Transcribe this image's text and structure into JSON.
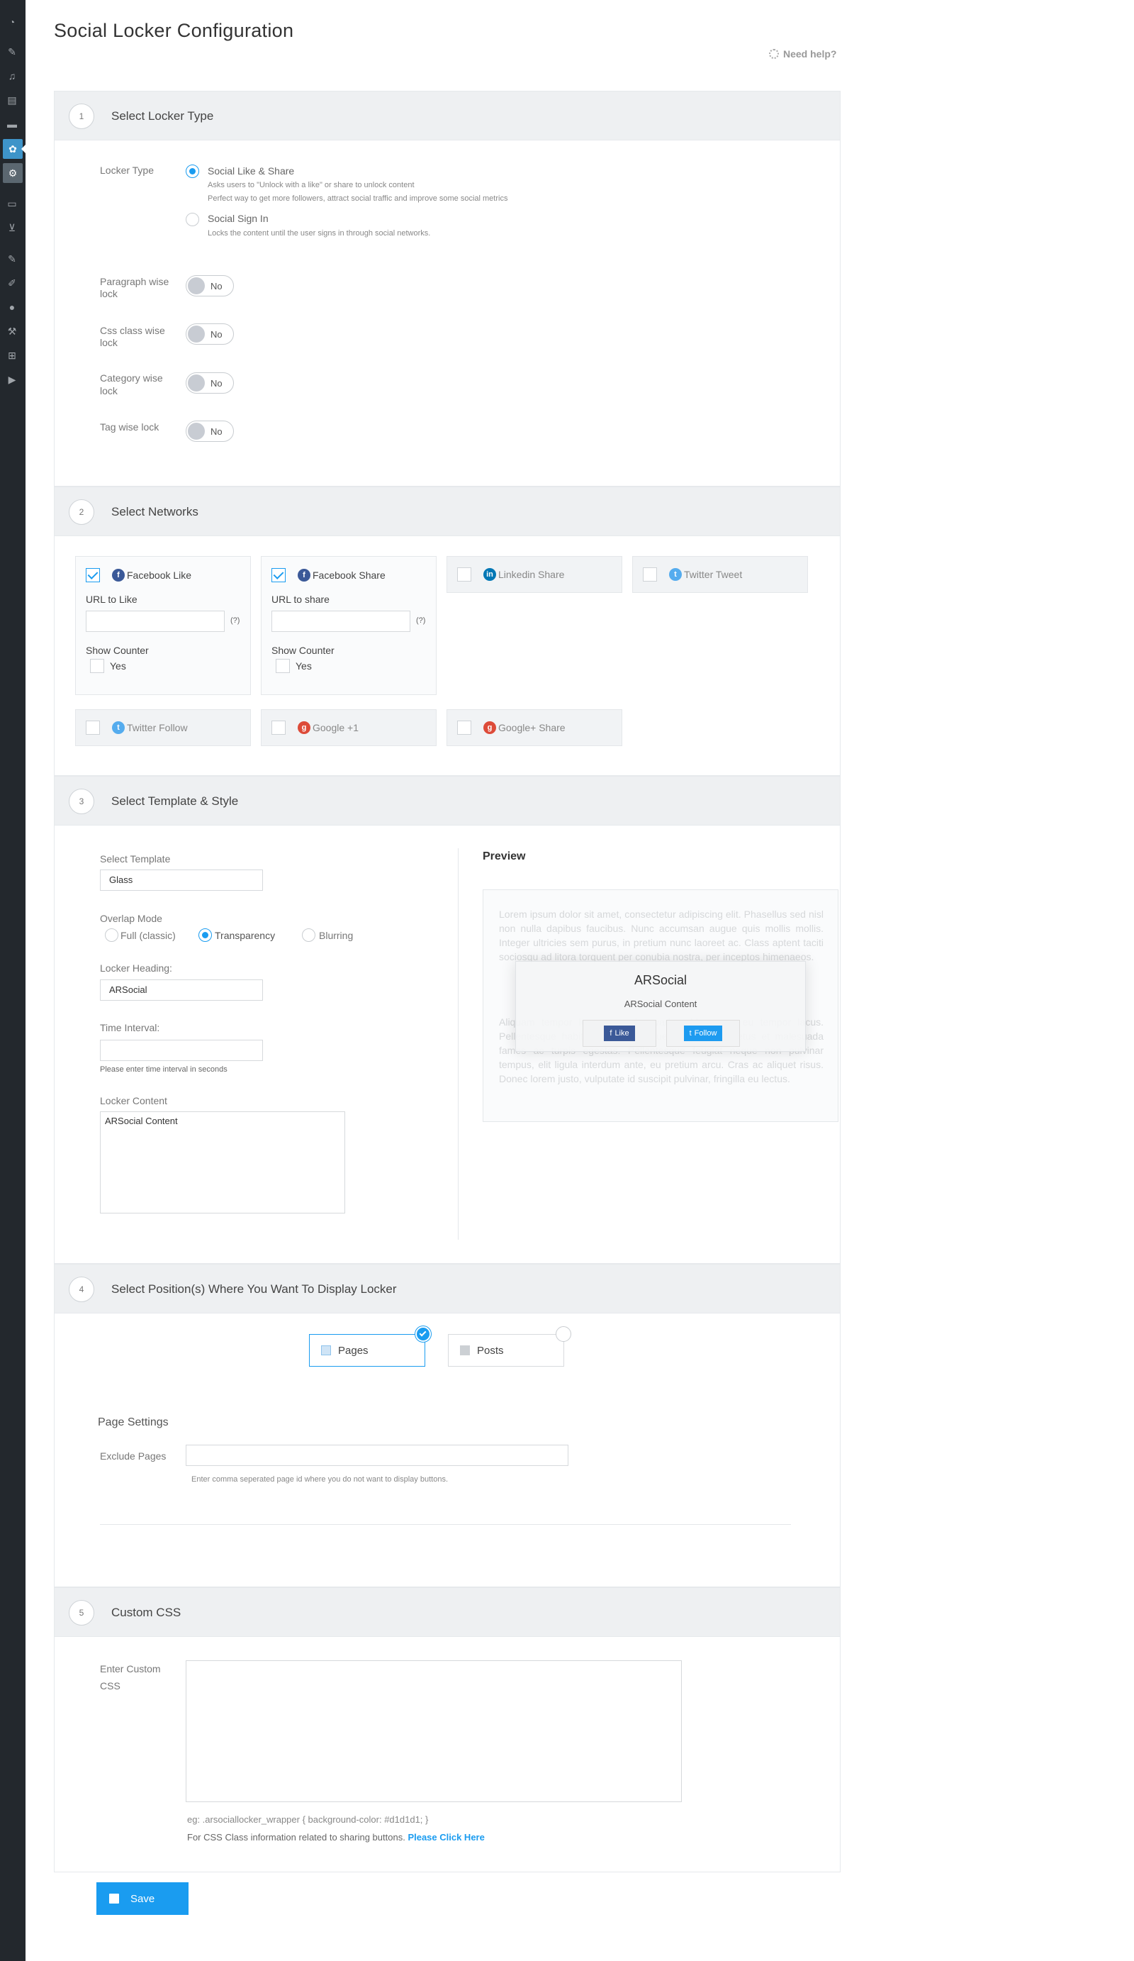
{
  "page": {
    "title": "Social Locker Configuration",
    "help_label": "Need help?"
  },
  "sidebar": {
    "icons": [
      "dashboard-icon",
      "pin-icon",
      "media-icon",
      "pages-icon",
      "comments-icon",
      "social-locker-icon",
      "locker-settings-icon",
      "forms-icon",
      "cart-icon",
      "plugins-icon",
      "appearance-icon",
      "users-icon",
      "tools-icon",
      "settings-icon",
      "play-icon"
    ]
  },
  "sections": {
    "s1": {
      "num": "1",
      "title": "Select Locker Type"
    },
    "s2": {
      "num": "2",
      "title": "Select Networks"
    },
    "s3": {
      "num": "3",
      "title": "Select Template & Style"
    },
    "s4": {
      "num": "4",
      "title": "Select Position(s) Where You Want To Display Locker"
    },
    "s5": {
      "num": "5",
      "title": "Custom CSS"
    }
  },
  "locker_type": {
    "label": "Locker Type",
    "opt1": {
      "label": "Social Like & Share",
      "desc1": "Asks users to \"Unlock with a like\" or share to unlock content",
      "desc2": "Perfect way to get more followers, attract social traffic and improve some social metrics",
      "selected": true
    },
    "opt2": {
      "label": "Social Sign In",
      "desc": "Locks the content until the user signs in through social networks.",
      "selected": false
    }
  },
  "toggles": {
    "paragraph": {
      "label1": "Paragraph wise",
      "label2": "lock",
      "value": "No"
    },
    "css": {
      "label1": "Css class wise",
      "label2": "lock",
      "value": "No"
    },
    "category": {
      "label1": "Category wise",
      "label2": "lock",
      "value": "No"
    },
    "tag": {
      "label": "Tag wise lock",
      "value": "No"
    }
  },
  "networks": {
    "fb_like": {
      "label": "Facebook Like",
      "checked": true,
      "url_label": "URL to Like",
      "url_value": "",
      "help": "(?)",
      "counter_label": "Show Counter",
      "counter_opt": "Yes"
    },
    "fb_share": {
      "label": "Facebook Share",
      "checked": true,
      "url_label": "URL to share",
      "url_value": "",
      "help": "(?)",
      "counter_label": "Show Counter",
      "counter_opt": "Yes"
    },
    "linkedin": {
      "label": "Linkedin Share",
      "checked": false
    },
    "tw_tweet": {
      "label": "Twitter Tweet",
      "checked": false
    },
    "tw_follow": {
      "label": "Twitter Follow",
      "checked": false
    },
    "gplus1": {
      "label": "Google +1",
      "checked": false
    },
    "gplus_share": {
      "label": "Google+ Share",
      "checked": false
    }
  },
  "template": {
    "select_label": "Select Template",
    "select_value": "Glass",
    "overlap_label": "Overlap Mode",
    "overlap_opts": [
      "Full (classic)",
      "Transparency",
      "Blurring"
    ],
    "overlap_selected": "Transparency",
    "heading_label": "Locker Heading:",
    "heading_value": "ARSocial",
    "interval_label": "Time Interval:",
    "interval_value": "",
    "interval_hint": "Please enter time interval in seconds",
    "content_label": "Locker Content",
    "content_value": "ARSocial Content"
  },
  "preview": {
    "title": "Preview",
    "lorem1": "Lorem ipsum dolor sit amet, consectetur adipiscing elit. Phasellus sed nisl non nulla dapibus faucibus. Nunc accumsan augue quis mollis mollis. Integer ultricies sem purus, in pretium nunc laoreet ac. Class aptent taciti sociosqu ad litora torquent per conubia nostra, per inceptos himenaeos.",
    "lorem2": "Aliquam tempor leo nec varius varius. Maecenas eu tempor lacus. Pellentesque habitant morbi tristique senectus et netus et malesuada fames ac turpis egestas. Pellentesque feugiat neque non pulvinar tempus, elit ligula interdum ante, eu pretium arcu. Cras ac aliquet risus. Donec lorem justo, vulputate id suscipit pulvinar, fringilla eu lectus.",
    "heading": "ARSocial",
    "content": "ARSocial Content",
    "like_btn": "Like",
    "follow_btn": "Follow"
  },
  "positions": {
    "pages": {
      "label": "Pages",
      "selected": true
    },
    "posts": {
      "label": "Posts",
      "selected": false
    },
    "settings_title": "Page Settings",
    "exclude_label": "Exclude Pages",
    "exclude_value": "",
    "exclude_hint": "Enter comma seperated page id where you do not want to display buttons."
  },
  "custom_css": {
    "label1": "Enter Custom",
    "label2": "CSS",
    "value": "",
    "example": "eg: .arsociallocker_wrapper { background-color: #d1d1d1; }",
    "info": "For CSS Class information related to sharing buttons.",
    "link": "Please Click Here"
  },
  "save_label": "Save",
  "colors": {
    "accent": "#1a9cf0",
    "sidebar": "#23282d",
    "facebook": "#3b5998",
    "twitter": "#55acee",
    "linkedin": "#0077b5",
    "google": "#dd4b39"
  }
}
